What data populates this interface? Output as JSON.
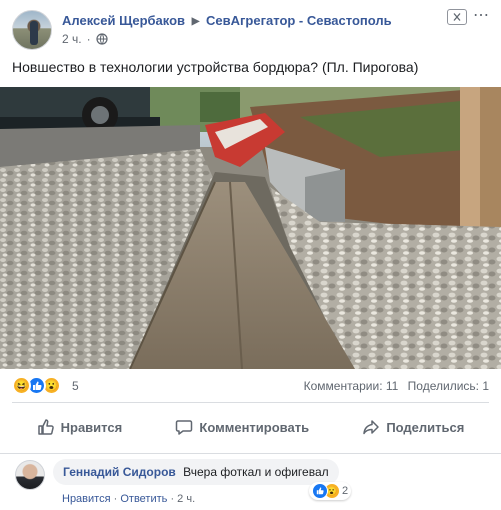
{
  "post": {
    "author": "Алексей Щербаков",
    "group": "СевАгрегатор - Севастополь",
    "time": "2 ч.",
    "separator": "·",
    "text": "Новшество в технологии устройства бордюра? (Пл. Пирогова)"
  },
  "reactions": {
    "count": "5",
    "comments_label": "Комментарии: 11",
    "shares_label": "Поделились: 1"
  },
  "actions": {
    "like": "Нравится",
    "comment": "Комментировать",
    "share": "Поделиться"
  },
  "comment": {
    "author": "Геннадий Сидоров",
    "text": "Вчера фоткал и офигевал",
    "like_label": "Нравится",
    "reply_label": "Ответить",
    "separator": "·",
    "time": "2 ч.",
    "reaction_count": "2"
  },
  "colors": {
    "link": "#385898",
    "like_blue": "#1877f2",
    "reaction_yellow": "#f7b125",
    "muted_text": "#606770"
  }
}
